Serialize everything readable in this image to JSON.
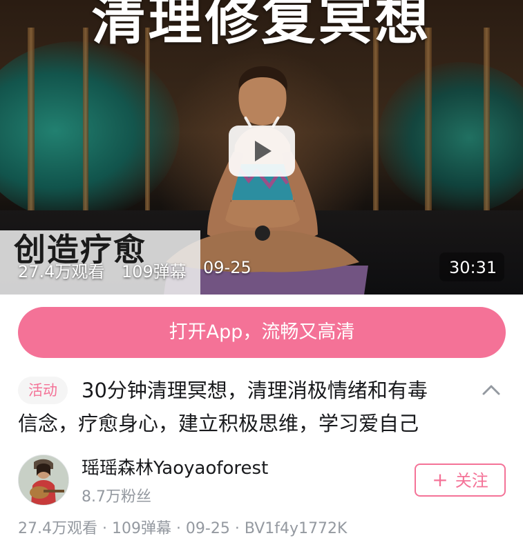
{
  "player": {
    "title_overlay": "清理修复冥想",
    "subtitle_overlay": "创造疗愈",
    "views": "27.4万观看",
    "danmaku": "109弹幕",
    "date": "09-25",
    "duration": "30:31"
  },
  "open_app": {
    "label": "打开App，流畅又高清"
  },
  "video": {
    "badge": "活动",
    "title_line1": "30分钟清理冥想，清理消极情绪和有毒",
    "title_line2": "信念，疗愈身心，建立积极思维，学习爱自己"
  },
  "uploader": {
    "name": "瑶瑶森林Yaoyaoforest",
    "fans": "8.7万粉丝",
    "follow_label": "关注",
    "follow_icon": "+"
  },
  "stats_line": "27.4万观看 · 109弹幕 · 09-25 · BV1f4y1772K",
  "colors": {
    "accent": "#f47297",
    "muted_text": "#9499a0",
    "primary_text": "#18191c"
  },
  "icons": {
    "play": "play-icon",
    "chevron": "chevron-up-icon",
    "plus": "plus-icon"
  }
}
